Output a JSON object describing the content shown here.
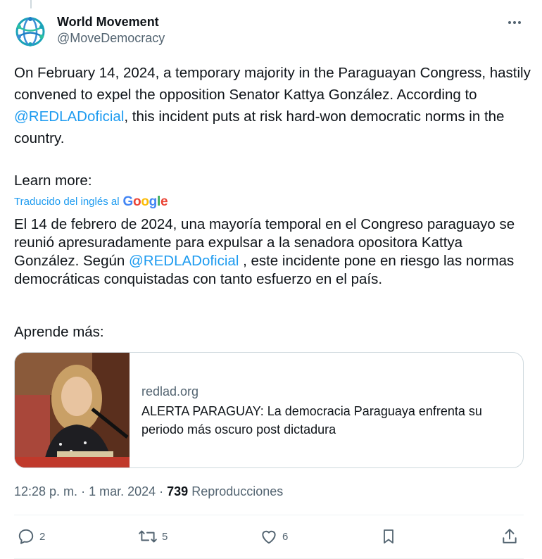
{
  "author": {
    "name": "World Movement",
    "handle": "@MoveDemocracy",
    "avatar_icon": "globe-network-logo-icon"
  },
  "tweet": {
    "text_en_part1": "On February 14, 2024, a temporary majority in the Paraguayan Congress, hastily convened to expel the opposition Senator Kattya González. According to ",
    "mention": "@REDLADoficial",
    "text_en_part2": ", this incident puts at risk hard-won democratic norms in the country.",
    "learn_more": "Learn more:",
    "translated_label": "Traducido del inglés al",
    "translated_provider": "Google",
    "text_es_part1": "El 14 de febrero de 2024, una mayoría temporal en el Congreso paraguayo se reunió apresuradamente para expulsar a la senadora opositora Kattya González. Según ",
    "mention_es": "@REDLADoficial",
    "text_es_part2": " , este incidente pone en riesgo las normas democráticas conquistadas con tanto esfuerzo en el país.",
    "aprende": "Aprende más:"
  },
  "card": {
    "domain": "redlad.org",
    "title": "ALERTA PARAGUAY: La democracia Paraguaya enfrenta su periodo más oscuro post dictadura",
    "image_icon": "senator-photo"
  },
  "meta": {
    "time": "12:28 p. m.",
    "date": "1 mar. 2024",
    "views": "739",
    "views_label": "Reproducciones"
  },
  "actions": {
    "replies": "2",
    "retweets": "5",
    "likes": "6"
  },
  "colors": {
    "link": "#1d9bf0",
    "secondary_text": "#536471",
    "border": "#cfd9de"
  }
}
